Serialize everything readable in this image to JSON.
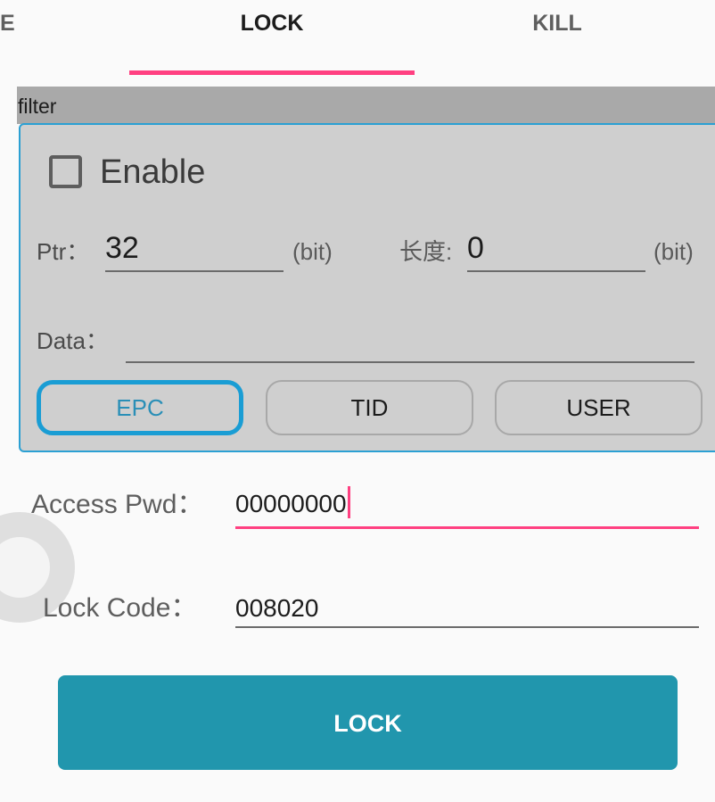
{
  "tabs": {
    "prev_label": "E",
    "lock_label": "LOCK",
    "kill_label": "KILL"
  },
  "filter": {
    "header": "filter",
    "enable_label": "Enable",
    "enable_checked": false,
    "ptr_label": "Ptr：",
    "ptr_value": "32",
    "ptr_unit": "(bit)",
    "len_label": "长度:",
    "len_value": "0",
    "len_unit": "(bit)",
    "data_label": "Data：",
    "data_value": "",
    "bank_buttons": [
      "EPC",
      "TID",
      "USER"
    ],
    "selected_bank": "EPC"
  },
  "access": {
    "label": "Access Pwd：",
    "value": "00000000"
  },
  "lock_code": {
    "label": "Lock Code：",
    "value": "008020"
  },
  "actions": {
    "lock_button": "LOCK"
  },
  "colors": {
    "accent": "#ff4081",
    "primary_button": "#2196ad",
    "selected_outline": "#1a9dd4"
  }
}
